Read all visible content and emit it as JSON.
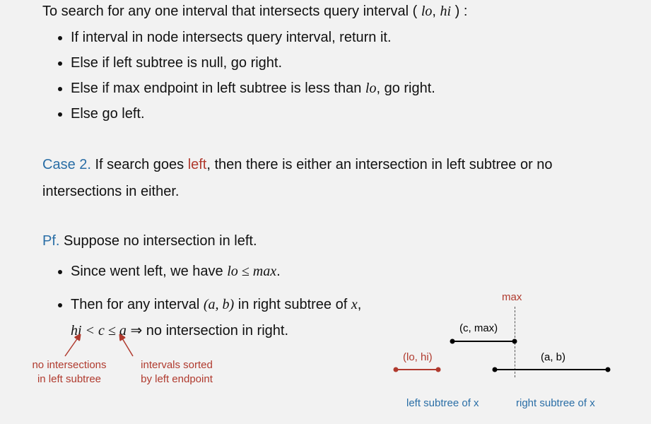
{
  "intro": {
    "prefix": "To search for any one interval that intersects query interval ( ",
    "lo": "lo",
    "comma": ",  ",
    "hi": "hi",
    "suffix": " ) :"
  },
  "alg": [
    "If interval in node intersects query interval, return it.",
    "Else if left subtree is null, go right.",
    "Else if max endpoint in left subtree is less than lo, go right.",
    "Else go left."
  ],
  "alg_item3": {
    "p1": "Else if max endpoint in left subtree is less than ",
    "lo": "lo",
    "p2": ", go right."
  },
  "case2": {
    "label": "Case 2.",
    "p1": "  If search goes ",
    "left": "left",
    "p2": ", then there is either an intersection in left subtree or no intersections in either."
  },
  "pf": {
    "label": "Pf.",
    "line": "  Suppose no intersection in left."
  },
  "pf_items": {
    "i1": {
      "p1": "Since went left, we have ",
      "expr": "lo  ≤  max",
      "p2": "."
    },
    "i2": {
      "p1": "Then for any interval ",
      "ab": "(a, b)",
      "p2": "  in right subtree of ",
      "x": "x",
      "p3": ",",
      "line2_expr": "hi  < c  ≤  a",
      "arrow": "  ⇒  ",
      "line2_tail": "no intersection in right."
    }
  },
  "annotations": {
    "a1_l1": "no intersections",
    "a1_l2": "in left subtree",
    "a2_l1": "intervals sorted",
    "a2_l2": "by left endpoint"
  },
  "diagram": {
    "max": "max",
    "cmax": "(c, max)",
    "lohi": "(lo, hi)",
    "ab": "(a, b)",
    "left_sub": "left subtree of x",
    "right_sub": "right subtree of x"
  }
}
